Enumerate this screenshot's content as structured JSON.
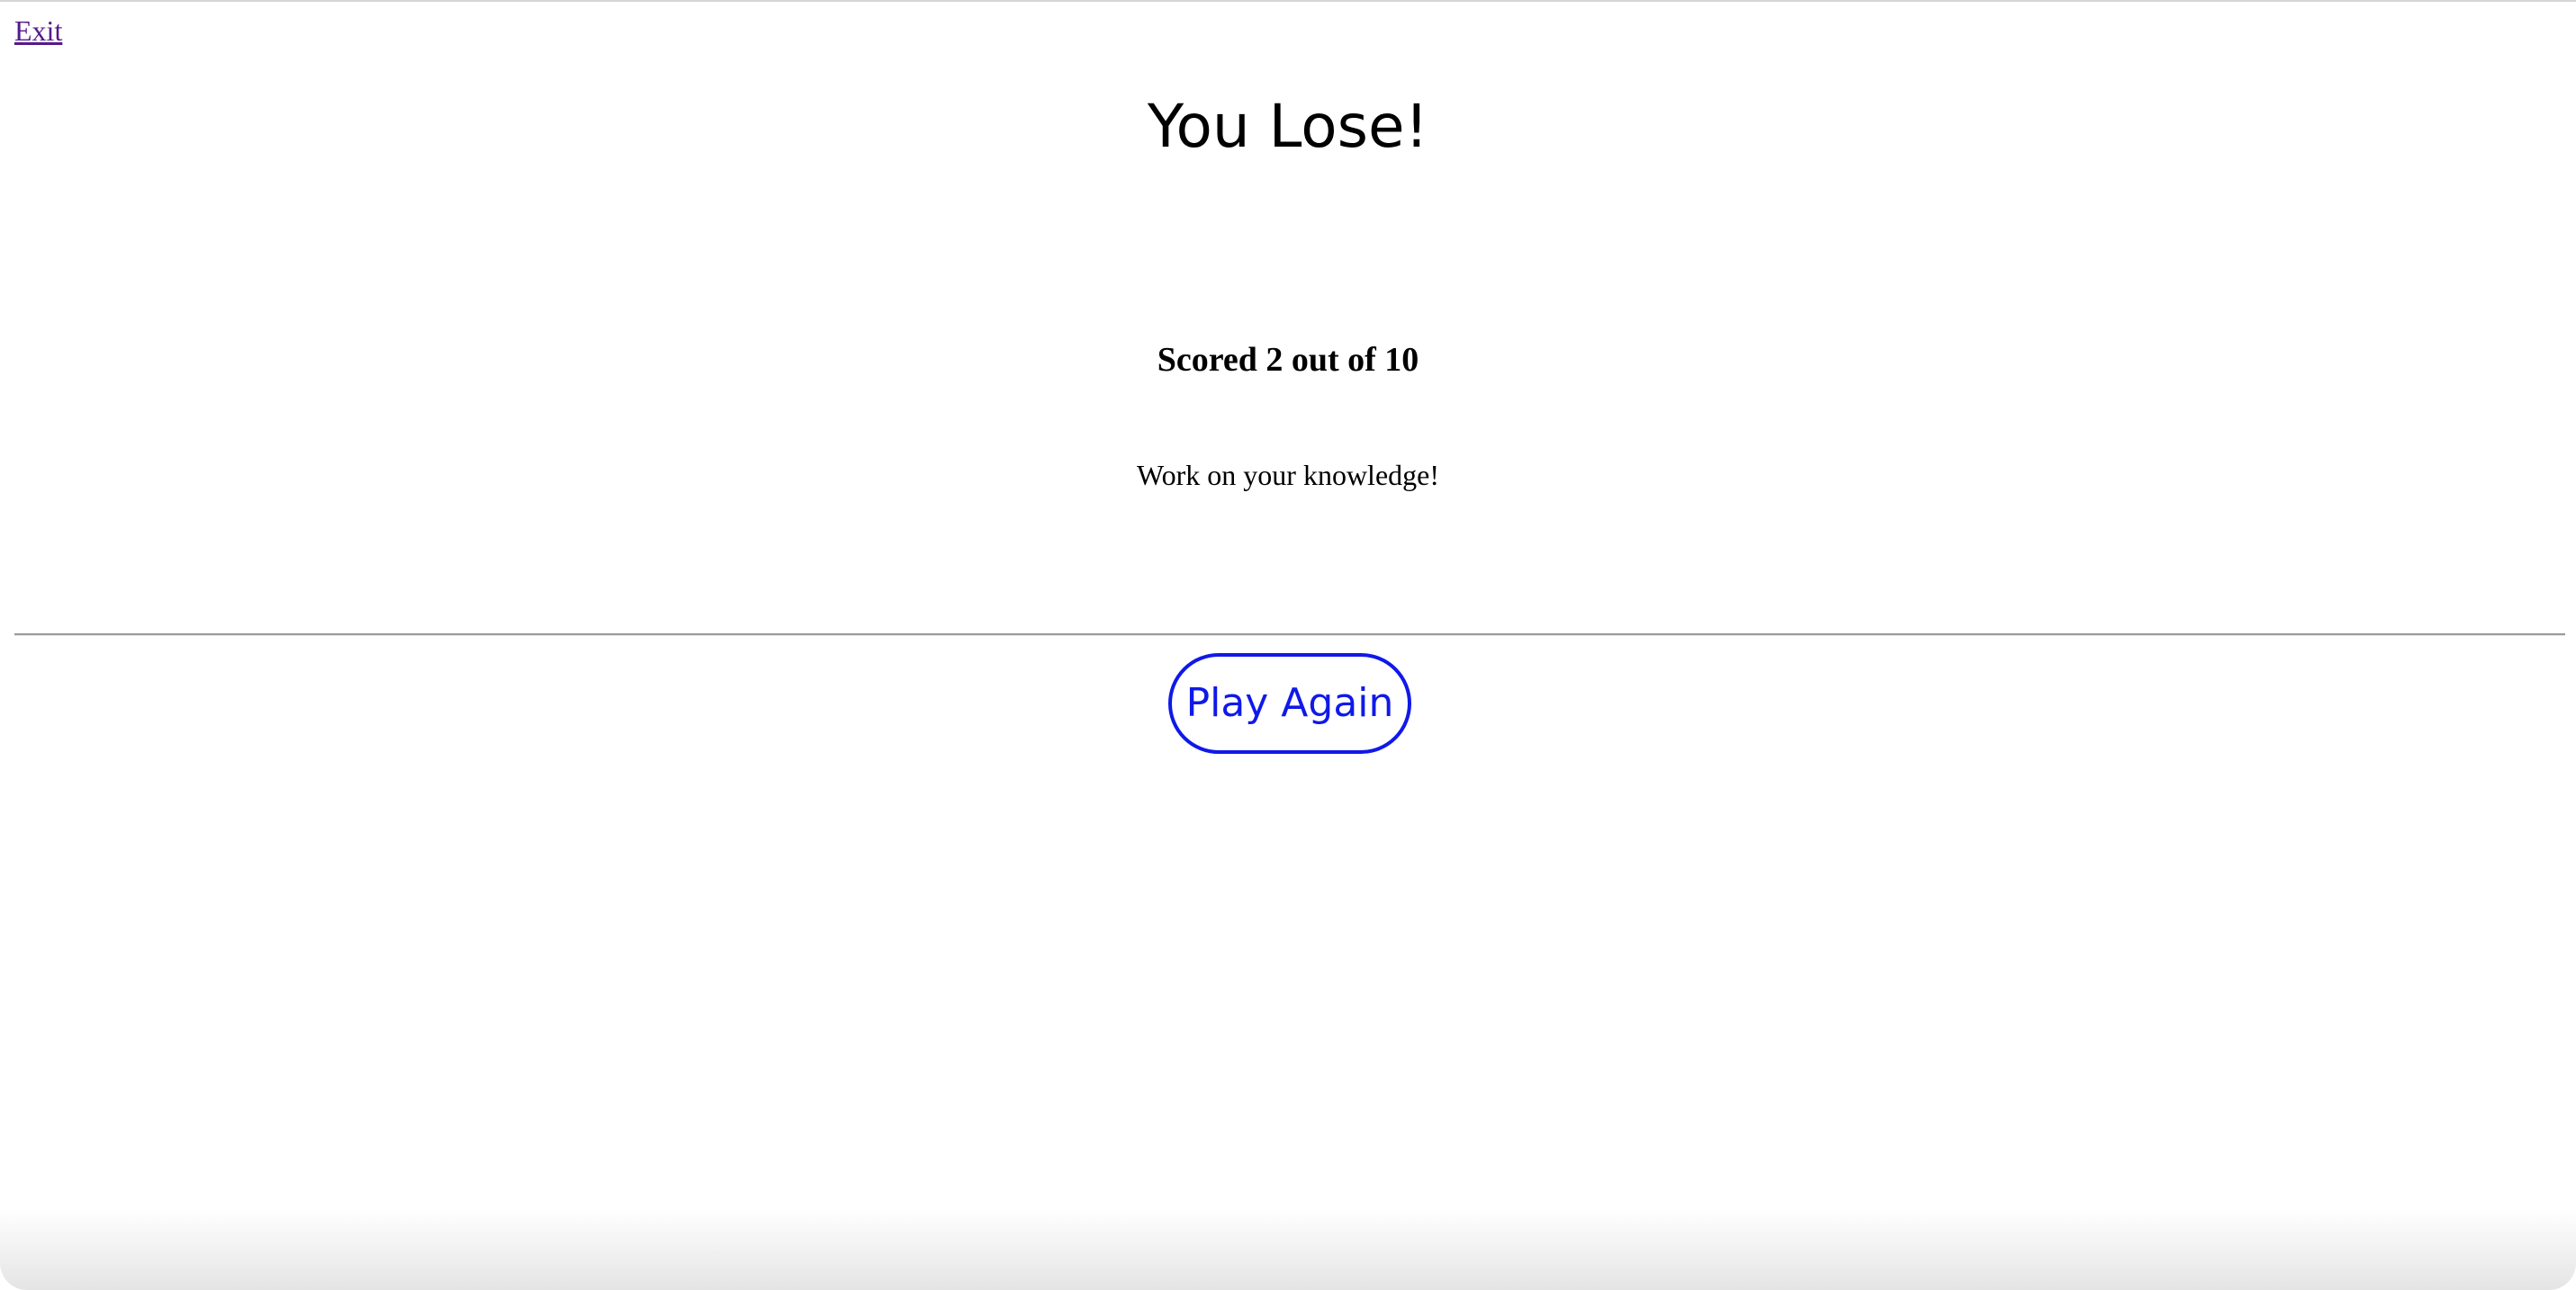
{
  "nav": {
    "exit_label": "Exit"
  },
  "result": {
    "title": "You Lose!",
    "score_text": "Scored 2 out of 10",
    "score": 2,
    "total": 10,
    "message": "Work on your knowledge!"
  },
  "actions": {
    "play_again_label": "Play Again"
  },
  "colors": {
    "link_visited": "#551a8b",
    "button_accent": "#1019e8",
    "text": "#000000",
    "background": "#ffffff",
    "divider": "#9a9a9a"
  }
}
